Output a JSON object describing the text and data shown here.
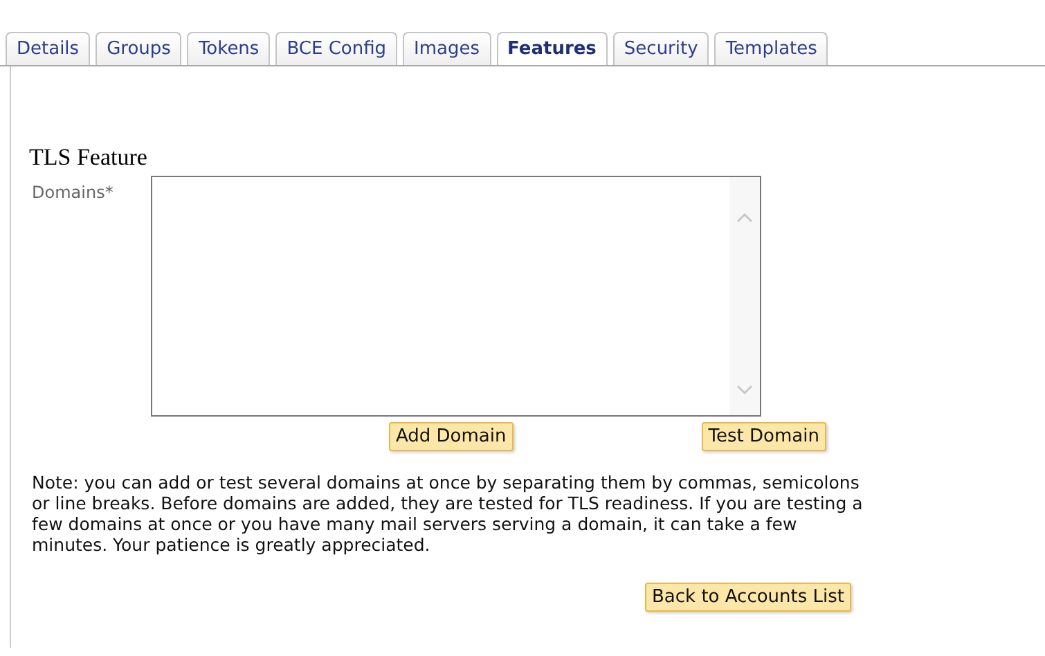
{
  "tabs": [
    {
      "label": "Details",
      "selected": false
    },
    {
      "label": "Groups",
      "selected": false
    },
    {
      "label": "Tokens",
      "selected": false
    },
    {
      "label": "BCE Config",
      "selected": false
    },
    {
      "label": "Images",
      "selected": false
    },
    {
      "label": "Features",
      "selected": true
    },
    {
      "label": "Security",
      "selected": false
    },
    {
      "label": "Templates",
      "selected": false
    }
  ],
  "section_title": "TLS Feature",
  "domains_label": "Domains*",
  "add_button": "Add Domain",
  "test_button": "Test Domain",
  "note": "Note: you can add or test several domains at once by separating them by commas, semicolons or line breaks. Before domains are added, they are tested for TLS readiness. If you are testing a few domains at once or you have many mail servers serving a domain, it can take a few minutes. Your patience is greatly appreciated.",
  "back_button": "Back to Accounts List"
}
